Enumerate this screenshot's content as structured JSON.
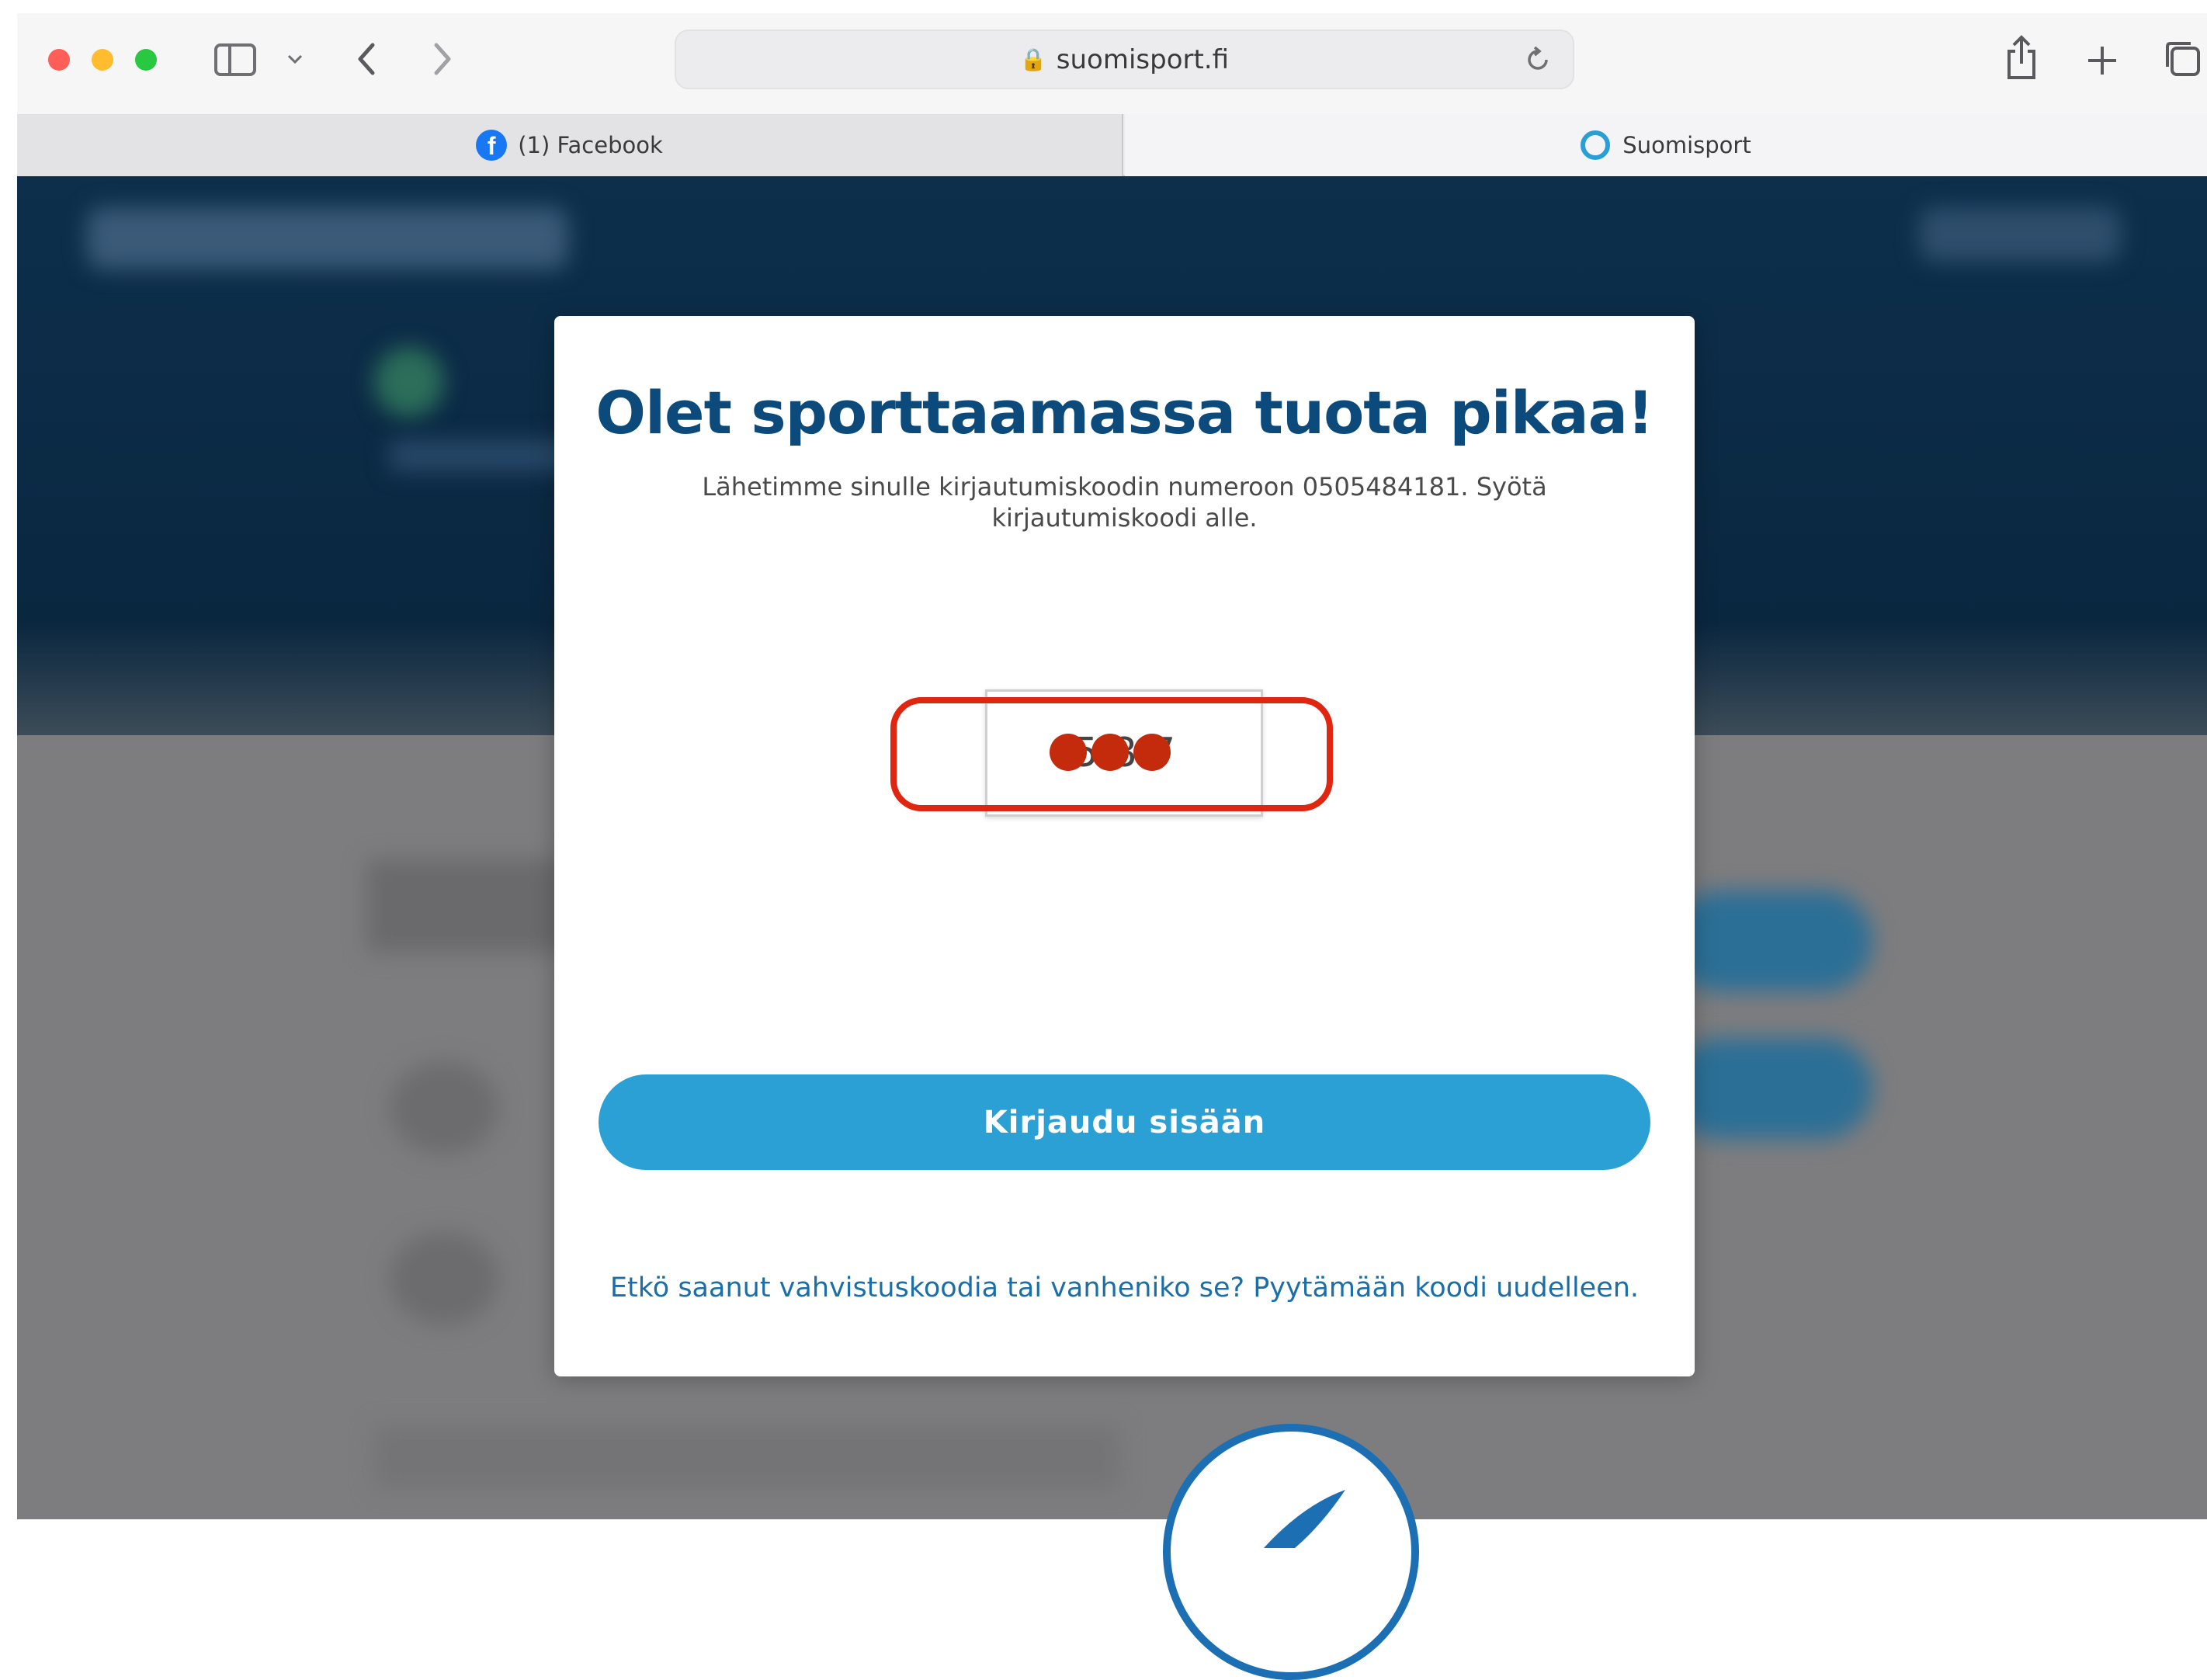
{
  "browser": {
    "url": "suomisport.fi",
    "tabs": [
      {
        "label": "(1) Facebook",
        "active": false
      },
      {
        "label": "Suomisport",
        "active": true
      }
    ]
  },
  "modal": {
    "title": "Olet sporttaamassa tuota pikaa!",
    "description": "Lähetimme sinulle kirjautumiskoodin numeroon 0505484181. Syötä kirjautumiskoodi alle.",
    "code_value": "5 8 7",
    "login_button": "Kirjaudu sisään",
    "resend_link": "Etkö saanut vahvistuskoodia tai vanheniko se? Pyytämään koodi uudelleen."
  },
  "colors": {
    "title": "#0b4a7a",
    "button": "#2aa0d5",
    "link": "#1a6fa8",
    "annotation": "#e02510",
    "hero": "#0a2740"
  },
  "icons": [
    "sidebar-icon",
    "chevron-down-icon",
    "back-icon",
    "forward-icon",
    "lock-icon",
    "reload-icon",
    "share-icon",
    "plus-icon",
    "tabs-icon",
    "facebook-icon",
    "suomisport-icon",
    "suomisport-logo"
  ]
}
